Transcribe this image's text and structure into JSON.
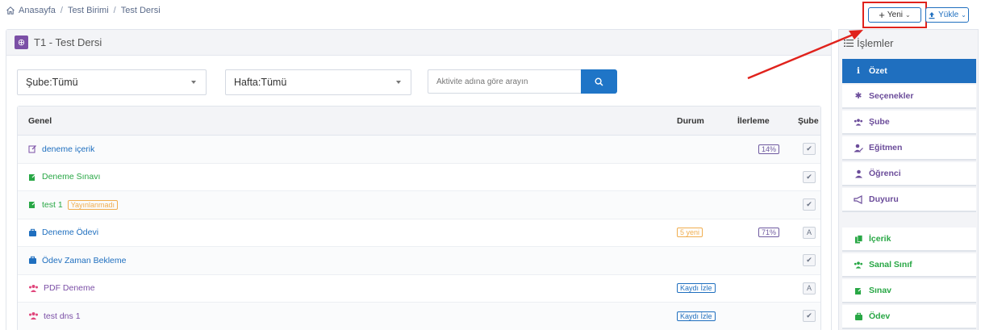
{
  "breadcrumb": {
    "home": "Anasayfa",
    "level2": "Test Birimi",
    "level3": "Test Dersi",
    "separator": "/"
  },
  "toolbar": {
    "new_label": "Yeni",
    "upload_label": "Yükle"
  },
  "course": {
    "title": "T1 - Test Dersi"
  },
  "filters": {
    "sube_value": "Şube:Tümü",
    "hafta_value": "Hafta:Tümü",
    "search_placeholder": "Aktivite adına göre arayın"
  },
  "table": {
    "headers": {
      "genel": "Genel",
      "durum": "Durum",
      "ilerleme": "İlerleme",
      "sube": "Şube"
    },
    "rows": [
      {
        "name": "deneme içerik",
        "icon": "edit-outline-icon",
        "color": "#1f6fbf",
        "badge": "",
        "durum": "",
        "ilerleme": "14%",
        "sube": "✔"
      },
      {
        "name": "Deneme Sınavı",
        "icon": "edit-icon",
        "color": "#28a745",
        "badge": "",
        "durum": "",
        "ilerleme": "",
        "sube": "✔"
      },
      {
        "name": "test 1",
        "icon": "edit-icon",
        "color": "#28a745",
        "badge": "Yayınlanmadı",
        "durum": "",
        "ilerleme": "",
        "sube": "✔"
      },
      {
        "name": "Deneme Ödevi",
        "icon": "briefcase-icon",
        "color": "#1f6fbf",
        "badge": "",
        "durum": "5 yeni",
        "ilerleme": "71%",
        "sube": "A"
      },
      {
        "name": "Ödev Zaman Bekleme",
        "icon": "briefcase-icon",
        "color": "#1f6fbf",
        "badge": "",
        "durum": "",
        "ilerleme": "",
        "sube": "✔"
      },
      {
        "name": "PDF Deneme",
        "icon": "users-icon",
        "color": "#7b4fa6",
        "badge": "",
        "durum": "Kaydı İzle",
        "ilerleme": "",
        "sube": "A"
      },
      {
        "name": "test dns 1",
        "icon": "users-icon",
        "color": "#7b4fa6",
        "badge": "",
        "durum": "Kaydı İzle",
        "ilerleme": "",
        "sube": "✔"
      }
    ]
  },
  "sidebar": {
    "title": "İşlemler",
    "items": [
      {
        "label": "Özet",
        "icon": "info-icon"
      },
      {
        "label": "Seçenekler",
        "icon": "gear-icon"
      },
      {
        "label": "Şube",
        "icon": "users-icon"
      },
      {
        "label": "Eğitmen",
        "icon": "user-edit-icon"
      },
      {
        "label": "Öğrenci",
        "icon": "user-icon"
      },
      {
        "label": "Duyuru",
        "icon": "megaphone-icon"
      },
      {
        "label": "İçerik",
        "icon": "files-icon"
      },
      {
        "label": "Sanal Sınıf",
        "icon": "users-icon"
      },
      {
        "label": "Sınav",
        "icon": "edit-icon"
      },
      {
        "label": "Ödev",
        "icon": "briefcase-icon"
      }
    ]
  },
  "colors": {
    "primary": "#1f6fbf",
    "green": "#28a745",
    "purple": "#7b4fa6",
    "warning": "#f0ad4e",
    "highlight": "#e0221c"
  }
}
